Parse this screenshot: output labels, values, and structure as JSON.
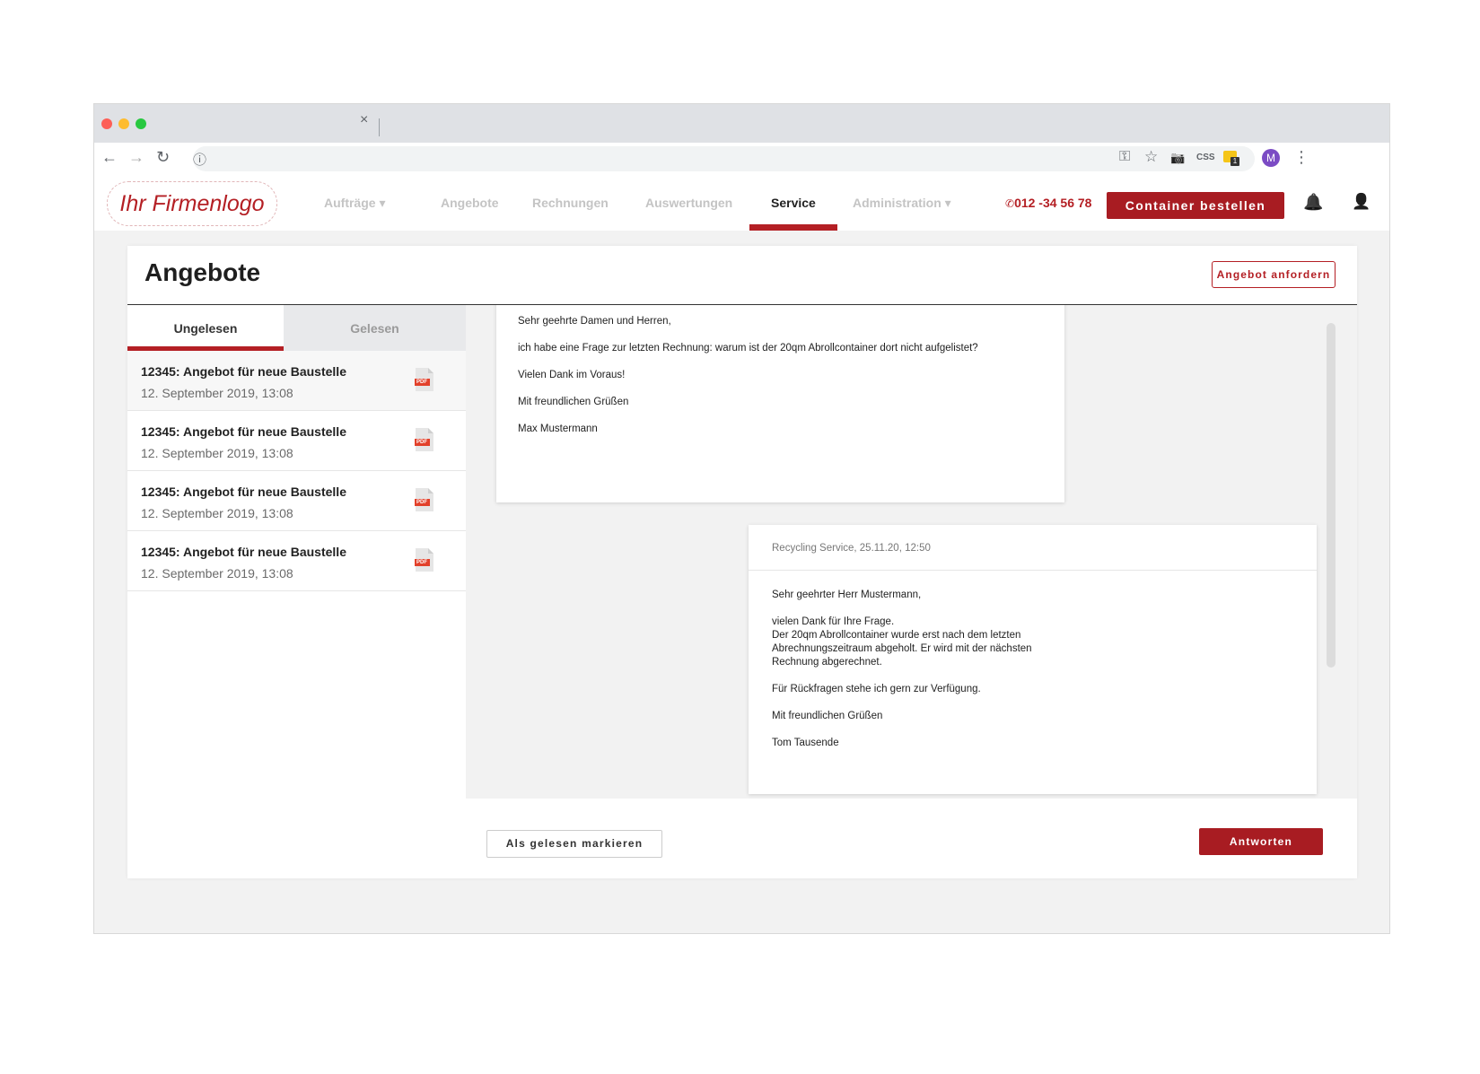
{
  "browser": {
    "tab_close": "×",
    "toolbar": {
      "back": "←",
      "forward": "→",
      "reload": "↻",
      "info": "ⓘ",
      "key": "⚿",
      "star": "☆",
      "camera": "📷",
      "css": "CSS",
      "ext_badge": "1",
      "avatar": "M",
      "menu": "⋮"
    }
  },
  "header": {
    "logo": "Ihr Firmenlogo",
    "nav": [
      {
        "label": "Aufträge ▾"
      },
      {
        "label": "Angebote"
      },
      {
        "label": "Rechnungen"
      },
      {
        "label": "Auswertungen"
      },
      {
        "label": "Service"
      },
      {
        "label": "Administration ▾"
      }
    ],
    "phone": "012 -34 56 78",
    "order_button": "Container bestellen",
    "bell_icon": "🔔",
    "user_icon": "👤"
  },
  "page": {
    "title": "Angebote",
    "request_button": "Angebot anfordern",
    "tabs": {
      "unread": "Ungelesen",
      "read": "Gelesen"
    },
    "items": [
      {
        "title": "12345: Angebot für neue Baustelle",
        "date": "12. September 2019, 13:08",
        "pdf": "PDF"
      },
      {
        "title": "12345: Angebot für neue Baustelle",
        "date": "12. September 2019, 13:08",
        "pdf": "PDF"
      },
      {
        "title": "12345: Angebot für neue Baustelle",
        "date": "12. September 2019, 13:08",
        "pdf": "PDF"
      },
      {
        "title": "12345: Angebot für neue Baustelle",
        "date": "12. September 2019, 13:08",
        "pdf": "PDF"
      }
    ],
    "message1": {
      "l1": "Sehr geehrte Damen und Herren,",
      "l2": "ich habe eine Frage zur letzten Rechnung: warum ist der 20qm Abrollcontainer dort nicht aufgelistet?",
      "l3": "Vielen Dank im Voraus!",
      "l4": "Mit freundlichen Grüßen",
      "l5": "Max Mustermann"
    },
    "message2": {
      "meta": "Recycling Service,  25.11.20, 12:50",
      "l1": "Sehr geehrter Herr Mustermann,",
      "l2": "vielen Dank für Ihre Frage.",
      "l3": "Der 20qm Abrollcontainer wurde erst nach dem letzten",
      "l4": "Abrechnungszeitraum abgeholt. Er wird mit der nächsten",
      "l5": "Rechnung abgerechnet.",
      "l6": "Für Rückfragen stehe ich gern zur Verfügung.",
      "l7": "Mit freundlichen Grüßen",
      "l8": "Tom Tausende"
    },
    "mark_read_button": "Als gelesen markieren",
    "reply_button": "Antworten"
  }
}
